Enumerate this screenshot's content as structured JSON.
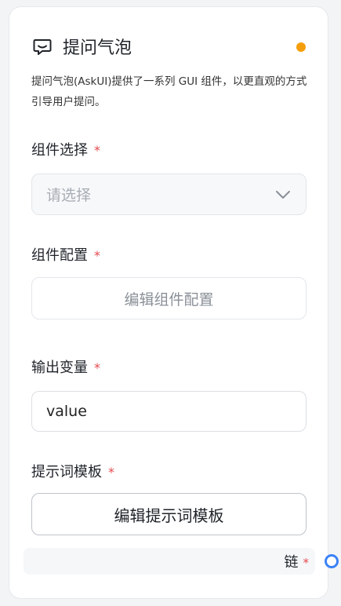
{
  "node": {
    "title": "提问气泡",
    "icon": "chat-bubble-icon",
    "status_color": "#f59e0b",
    "description": "提问气泡(AskUI)提供了一系列 GUI 组件，以更直观的方式引导用户提问。"
  },
  "fields": {
    "component_select": {
      "label": "组件选择",
      "required_mark": "*",
      "placeholder": "请选择"
    },
    "component_config": {
      "label": "组件配置",
      "required_mark": "*",
      "button_label": "编辑组件配置"
    },
    "output_variable": {
      "label": "输出变量",
      "required_mark": "*",
      "value": "value"
    },
    "prompt_template": {
      "label": "提示词模板",
      "required_mark": "*",
      "button_label": "编辑提示词模板"
    },
    "link": {
      "label": "链",
      "required_mark": "*"
    }
  },
  "colors": {
    "accent": "#3b82f6",
    "required": "#e5484d"
  }
}
